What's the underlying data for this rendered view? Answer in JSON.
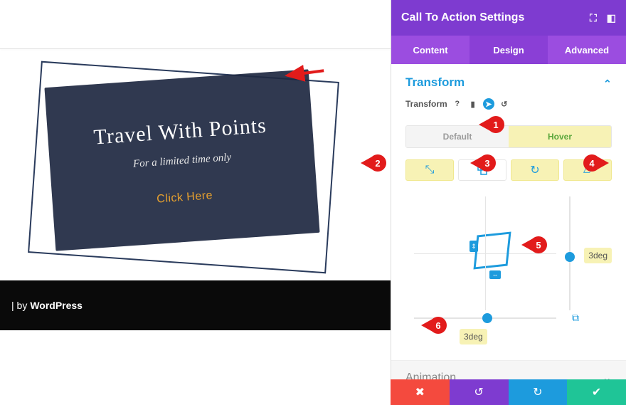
{
  "preview": {
    "cta": {
      "headline": "Travel With Points",
      "subheading": "For a limited time only",
      "button_label": "Click Here"
    },
    "footer_prefix": "| by ",
    "footer_brand": "WordPress"
  },
  "panel": {
    "title": "Call To Action Settings",
    "tabs": {
      "content": "Content",
      "design": "Design",
      "advanced": "Advanced"
    },
    "section": {
      "transform_title": "Transform",
      "property_label": "Transform",
      "state": {
        "default": "Default",
        "hover": "Hover"
      },
      "skew_x_value": "3deg",
      "skew_y_value": "3deg"
    },
    "animation_title": "Animation"
  },
  "markers": {
    "m1": "1",
    "m2": "2",
    "m3": "3",
    "m4": "4",
    "m5": "5",
    "m6": "6"
  },
  "icons": {
    "help": "?",
    "device": "▮",
    "cursor": "➤",
    "reset": "↺",
    "move": "⤡",
    "rotate": "↻",
    "skew": "▱",
    "link": "⧉",
    "close": "✖",
    "undo": "↺",
    "redo": "↻",
    "check": "✔",
    "chevron_down": "⌄",
    "expand": "⛶",
    "dock": "◧"
  }
}
